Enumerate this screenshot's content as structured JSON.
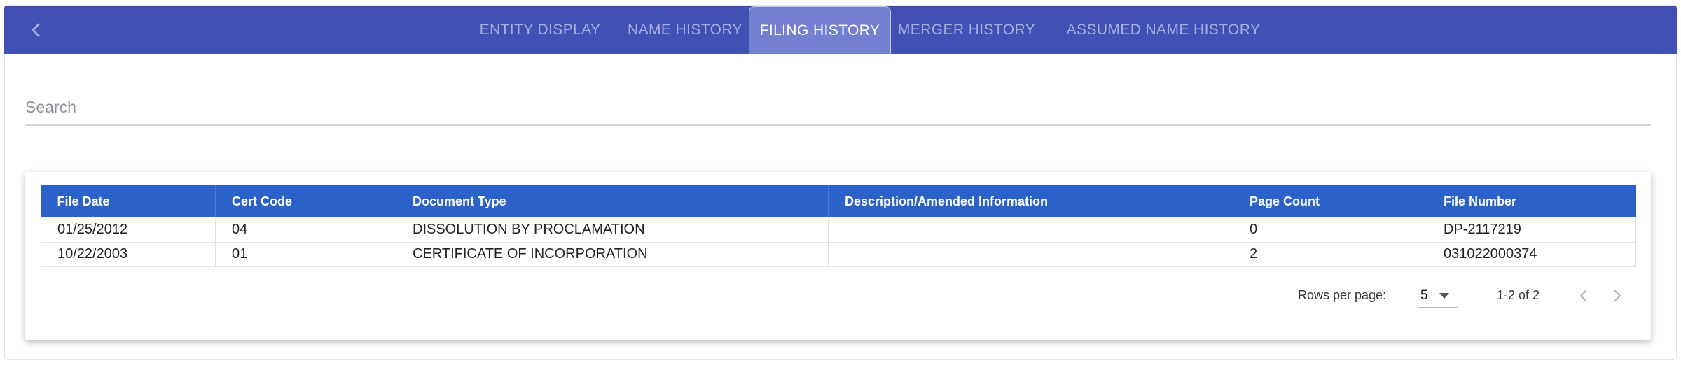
{
  "tabs": [
    {
      "label": "ENTITY DISPLAY",
      "active": false
    },
    {
      "label": "NAME HISTORY",
      "active": false
    },
    {
      "label": "FILING HISTORY",
      "active": true
    },
    {
      "label": "MERGER HISTORY",
      "active": false
    },
    {
      "label": "ASSUMED NAME HISTORY",
      "active": false
    }
  ],
  "icons": {
    "back": "chevron-left-icon",
    "prev": "chevron-left-icon",
    "next": "chevron-right-icon",
    "dropdown": "caret-down-icon"
  },
  "search": {
    "placeholder": "Search",
    "value": ""
  },
  "table": {
    "columns": [
      "File Date",
      "Cert Code",
      "Document Type",
      "Description/Amended Information",
      "Page Count",
      "File Number"
    ],
    "rows": [
      [
        "01/25/2012",
        "04",
        "DISSOLUTION BY PROCLAMATION",
        "",
        "0",
        "DP-2117219"
      ],
      [
        "10/22/2003",
        "01",
        "CERTIFICATE OF INCORPORATION",
        "",
        "2",
        "031022000374"
      ]
    ]
  },
  "pagination": {
    "rows_per_page_label": "Rows per page:",
    "rows_per_page_value": "5",
    "range_text": "1-2 of 2"
  },
  "colors": {
    "tabbar": "#4150b5",
    "tab_active": "#7380d2",
    "table_header": "#2a62c9"
  }
}
